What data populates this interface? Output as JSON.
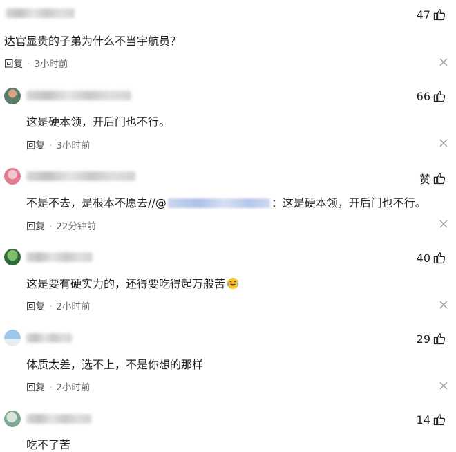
{
  "comments": [
    {
      "text": "达官显贵的子弟为什么不当宇航员？",
      "reply_label": "回复",
      "time": "3小时前",
      "likes": "47"
    },
    {
      "text": "这是硬本领，开后门也不行。",
      "reply_label": "回复",
      "time": "3小时前",
      "likes": "66"
    },
    {
      "text_before": "不是不去，是根本不愿去//@",
      "text_after": "：这是硬本领，开后门也不行。",
      "reply_label": "回复",
      "time": "22分钟前",
      "likes": "赞"
    },
    {
      "text": "这是要有硬实力的，还得要吃得起万般苦",
      "reply_label": "回复",
      "time": "2小时前",
      "likes": "40"
    },
    {
      "text": "体质太差，选不上，不是你想的那样",
      "reply_label": "回复",
      "time": "2小时前",
      "likes": "29"
    },
    {
      "text": "吃不了苦",
      "likes": "14"
    }
  ],
  "icons": {
    "like": "thumbs-up-icon",
    "close": "close-icon",
    "emoji": "laughing-crying-emoji"
  }
}
